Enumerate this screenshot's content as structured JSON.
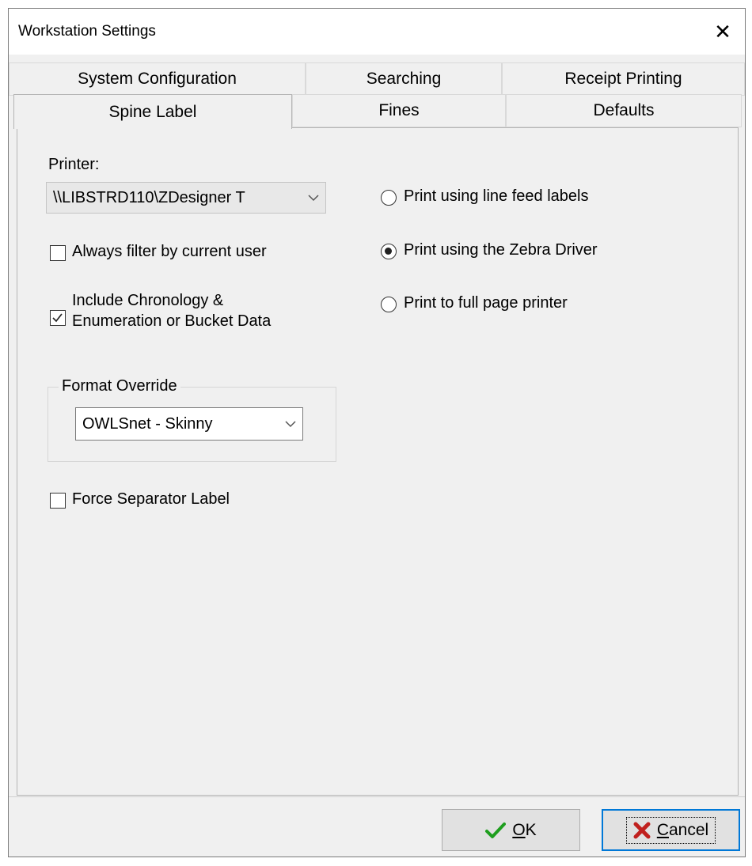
{
  "window": {
    "title": "Workstation Settings",
    "close_glyph": "✕"
  },
  "tabs": {
    "row1": [
      {
        "label": "System Configuration"
      },
      {
        "label": "Searching"
      },
      {
        "label": "Receipt Printing"
      }
    ],
    "row2": [
      {
        "label": "Spine Label",
        "active": true
      },
      {
        "label": "Fines"
      },
      {
        "label": "Defaults"
      }
    ]
  },
  "spine_label": {
    "printer_label": "Printer:",
    "printer_value": "\\\\LIBSTRD110\\ZDesigner T",
    "always_filter": {
      "label": "Always filter by current user",
      "checked": false
    },
    "include_chronology": {
      "label_line1": "Include Chronology &",
      "label_line2": "Enumeration or Bucket Data",
      "checked": true
    },
    "format_override": {
      "legend": "Format Override",
      "value": "OWLSnet - Skinny"
    },
    "force_separator": {
      "label": "Force Separator Label",
      "checked": false
    },
    "print_options": [
      {
        "label": "Print using line feed labels",
        "selected": false
      },
      {
        "label": "Print using the Zebra Driver",
        "selected": true
      },
      {
        "label": "Print to full page printer",
        "selected": false
      }
    ]
  },
  "buttons": {
    "ok": {
      "label_underlined": "O",
      "label_rest": "K"
    },
    "cancel": {
      "label_underlined": "C",
      "label_rest": "ancel"
    }
  },
  "colors": {
    "ok_check": "#1e9e1e",
    "cancel_x": "#c0201e",
    "focus_border": "#0078d7"
  }
}
